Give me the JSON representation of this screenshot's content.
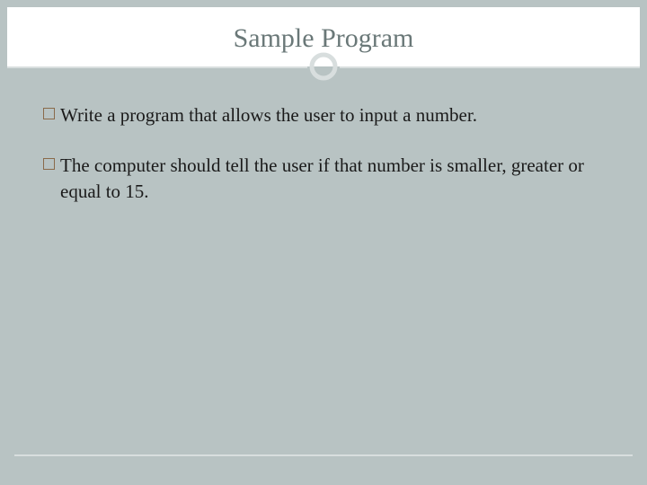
{
  "title": "Sample Program",
  "bullets": [
    "Write a program that allows the user to input a number.",
    "The computer should tell the user if that number is smaller, greater or equal to 15."
  ]
}
